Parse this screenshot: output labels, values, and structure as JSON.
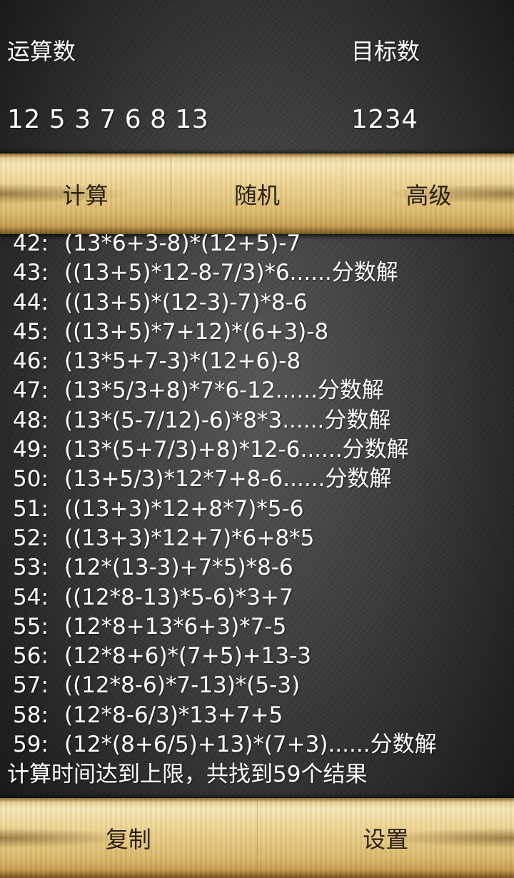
{
  "header": {
    "operands_label": "运算数",
    "operands_value": "12 5 3 7 6 8 13",
    "target_label": "目标数",
    "target_value": "1234"
  },
  "toolbar": {
    "calculate_label": "计算",
    "random_label": "随机",
    "advanced_label": "高级"
  },
  "results": [
    {
      "index": "42:",
      "expr": "(13*6+3-8)*(12+5)-7"
    },
    {
      "index": "43:",
      "expr": "((13+5)*12-8-7/3)*6......分数解"
    },
    {
      "index": "44:",
      "expr": "((13+5)*(12-3)-7)*8-6"
    },
    {
      "index": "45:",
      "expr": "((13+5)*7+12)*(6+3)-8"
    },
    {
      "index": "46:",
      "expr": "(13*5+7-3)*(12+6)-8"
    },
    {
      "index": "47:",
      "expr": "(13*5/3+8)*7*6-12......分数解"
    },
    {
      "index": "48:",
      "expr": "(13*(5-7/12)-6)*8*3......分数解"
    },
    {
      "index": "49:",
      "expr": "(13*(5+7/3)+8)*12-6......分数解"
    },
    {
      "index": "50:",
      "expr": "(13+5/3)*12*7+8-6......分数解"
    },
    {
      "index": "51:",
      "expr": "((13+3)*12+8*7)*5-6"
    },
    {
      "index": "52:",
      "expr": "((13+3)*12+7)*6+8*5"
    },
    {
      "index": "53:",
      "expr": "(12*(13-3)+7*5)*8-6"
    },
    {
      "index": "54:",
      "expr": "((12*8-13)*5-6)*3+7"
    },
    {
      "index": "55:",
      "expr": "(12*8+13*6+3)*7-5"
    },
    {
      "index": "56:",
      "expr": "(12*8+6)*(7+5)+13-3"
    },
    {
      "index": "57:",
      "expr": "((12*8-6)*7-13)*(5-3)"
    },
    {
      "index": "58:",
      "expr": "(12*8-6/3)*13+7+5"
    },
    {
      "index": "59:",
      "expr": "(12*(8+6/5)+13)*(7+3)......分数解"
    }
  ],
  "status_text": "计算时间达到上限，共找到59个结果",
  "footer": {
    "copy_label": "复制",
    "settings_label": "设置"
  }
}
